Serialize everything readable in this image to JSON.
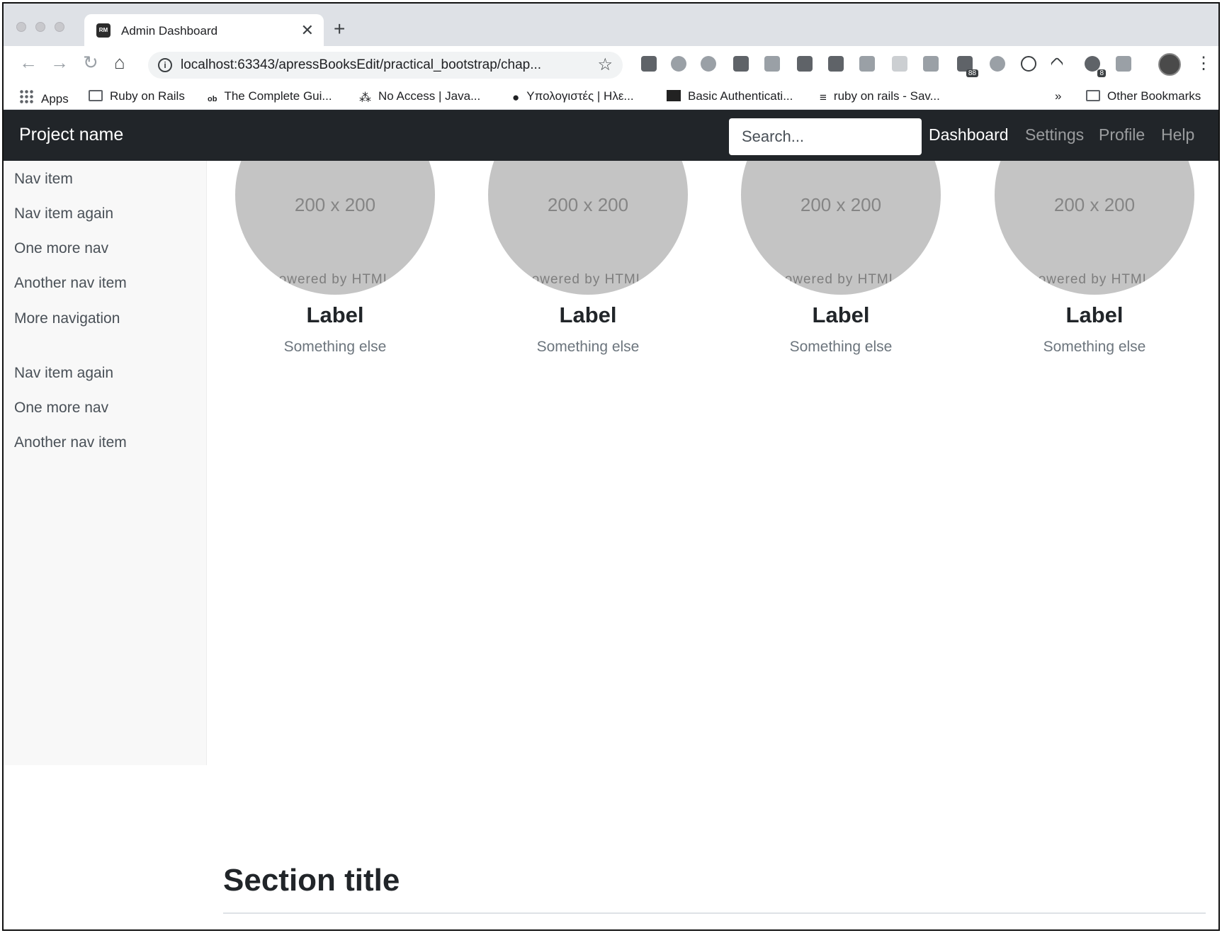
{
  "browser": {
    "tab_title": "Admin Dashboard",
    "tab_favicon_text": "RM",
    "new_tab": "+",
    "tab_close": "✕",
    "url": "localhost:63343/apressBooksEdit/practical_bootstrap/chap...",
    "back": "←",
    "forward": "→",
    "reload": "↻",
    "home": "⌂",
    "star": "☆",
    "menu": "⋮",
    "extension_badges": [
      "88",
      "8"
    ],
    "bookmarks": [
      {
        "label": "Apps",
        "icon": "apps-grid-icon"
      },
      {
        "label": "Ruby on Rails",
        "icon": "folder-icon"
      },
      {
        "label": "The Complete Gui...",
        "icon": "ob-icon"
      },
      {
        "label": "No Access | Java...",
        "icon": "nodes-icon"
      },
      {
        "label": "Υπολογιστές | Ηλε...",
        "icon": "balloon-icon"
      },
      {
        "label": "Basic Authenticati...",
        "icon": "diamond-icon"
      },
      {
        "label": "ruby on rails - Sav...",
        "icon": "stackoverflow-icon"
      }
    ],
    "bookmarks_overflow": "»",
    "other_bookmarks": "Other Bookmarks"
  },
  "navbar": {
    "brand": "Project name",
    "search_placeholder": "Search...",
    "links": [
      "Dashboard",
      "Settings",
      "Profile",
      "Help"
    ],
    "active": "Dashboard"
  },
  "sidebar": {
    "group1": [
      "Nav item",
      "Nav item again",
      "One more nav",
      "Another nav item",
      "More navigation"
    ],
    "group2": [
      "Nav item again",
      "One more nav",
      "Another nav item"
    ]
  },
  "placeholders": [
    {
      "size": "200 x 200",
      "powered": "owered by HTML",
      "label": "Label",
      "sub": "Something else"
    },
    {
      "size": "200 x 200",
      "powered": "owered by HTML",
      "label": "Label",
      "sub": "Something else"
    },
    {
      "size": "200 x 200",
      "powered": "owered by HTML",
      "label": "Label",
      "sub": "Something else"
    },
    {
      "size": "200 x 200",
      "powered": "owered by HTML",
      "label": "Label",
      "sub": "Something else"
    }
  ],
  "section": {
    "title": "Section title"
  },
  "colors": {
    "navbar_bg": "#212529",
    "sidebar_bg": "#f8f8f8",
    "placeholder_bg": "#c4c4c4"
  }
}
